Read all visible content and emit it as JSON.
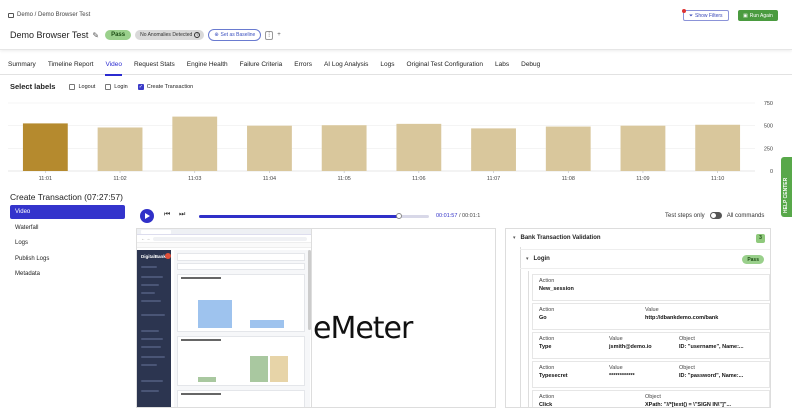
{
  "header": {
    "breadcrumb": "Demo / Demo Browser Test",
    "title": "Demo Browser Test",
    "status": "Pass",
    "anomalies": "No Anomalies Detected",
    "baseline": "Set as Baseline",
    "show_filters": "Show Filters",
    "run_again": "Run Again"
  },
  "tabs": [
    "Summary",
    "Timeline Report",
    "Video",
    "Request Stats",
    "Engine Health",
    "Failure Criteria",
    "Errors",
    "AI Log Analysis",
    "Logs",
    "Original Test Configuration",
    "Labs",
    "Debug"
  ],
  "active_tab": "Video",
  "labels": {
    "title": "Select labels",
    "options": [
      {
        "label": "Logout",
        "checked": false
      },
      {
        "label": "Login",
        "checked": false
      },
      {
        "label": "Create Transaction",
        "checked": true
      }
    ]
  },
  "chart_data": {
    "type": "bar",
    "categories": [
      "11:01",
      "11:02",
      "11:03",
      "11:04",
      "11:05",
      "11:06",
      "11:07",
      "11:08",
      "11:09",
      "11:10"
    ],
    "values": [
      525,
      480,
      600,
      500,
      505,
      520,
      470,
      490,
      500,
      510
    ],
    "highlight_index": 0,
    "yticks": [
      0,
      250,
      500,
      750
    ],
    "ylim": [
      0,
      750
    ],
    "colors": {
      "bar": "#d9c79c",
      "highlight": "#b58a2e"
    }
  },
  "left_panel": {
    "title": "Create Transaction (07:27:57)",
    "items": [
      "Video",
      "Waterfall",
      "Logs",
      "Publish Logs",
      "Metadata"
    ],
    "active": "Video"
  },
  "player": {
    "current": "00:01:57",
    "total": "00:01:1",
    "progress": 0.87,
    "test_steps_only": "Test steps only",
    "all_commands": "All commands"
  },
  "video": {
    "brand_fragment": "eMeter"
  },
  "steps": {
    "group": "Bank Transaction Validation",
    "group_count": "3",
    "sub": "Login",
    "sub_status": "Pass",
    "rows": [
      {
        "action_label": "Action",
        "action": "New_session"
      },
      {
        "action_label": "Action",
        "action": "Go",
        "value_label": "Value",
        "value": "http://dbankdemo.com/bank"
      },
      {
        "action_label": "Action",
        "action": "Type",
        "value_label": "Value",
        "value": "jsmith@demo.io",
        "object_label": "Object",
        "object": "ID: \"username\", Name:..."
      },
      {
        "action_label": "Action",
        "action": "Typesecret",
        "value_label": "Value",
        "value": "************",
        "object_label": "Object",
        "object": "ID: \"password\", Name:..."
      },
      {
        "action_label": "Action",
        "action": "Click",
        "object_label": "Object",
        "object": "XPath: \"//*[text() = \\\"SIGN IN\\\"]\"..."
      }
    ]
  },
  "help_center": "HELP CENTER"
}
